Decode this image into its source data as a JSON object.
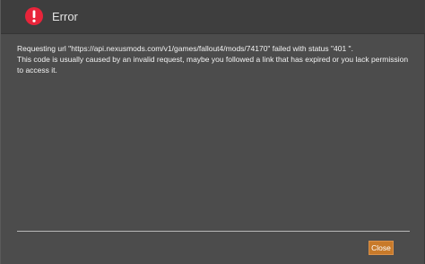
{
  "dialog": {
    "icon": "exclamation-circle-icon",
    "title": "Error",
    "message_line1": "Requesting url \"https://api.nexusmods.com/v1/games/fallout4/mods/74170\" failed with status \"401 \".",
    "message_line2": "This code is usually caused by an invalid request, maybe you followed a link that has expired or you lack permission to access it.",
    "close_label": "Close"
  },
  "colors": {
    "icon_red": "#e8243a",
    "button_orange": "#c87a2a",
    "panel": "#4c4c4c",
    "header": "#3e3e3e"
  }
}
